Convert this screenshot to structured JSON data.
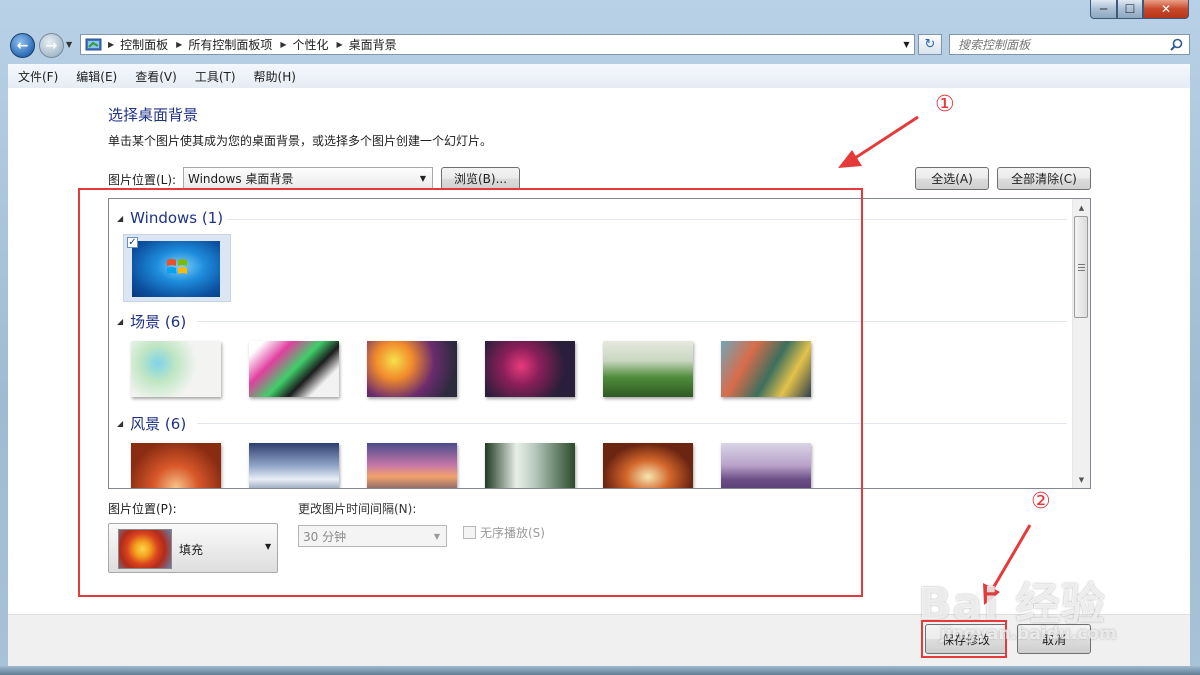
{
  "window": {
    "caption_min": "─",
    "caption_max": "☐",
    "caption_close": "✕"
  },
  "navigation": {
    "breadcrumbs": [
      "控制面板",
      "所有控制面板项",
      "个性化",
      "桌面背景"
    ],
    "search_placeholder": "搜索控制面板"
  },
  "menu": [
    "文件(F)",
    "编辑(E)",
    "查看(V)",
    "工具(T)",
    "帮助(H)"
  ],
  "page": {
    "title": "选择桌面背景",
    "subtitle": "单击某个图片使其成为您的桌面背景，或选择多个图片创建一个幻灯片。",
    "location_label": "图片位置(L):",
    "location_value": "Windows 桌面背景",
    "browse_label": "浏览(B)...",
    "select_all_label": "全选(A)",
    "clear_all_label": "全部清除(C)"
  },
  "gallery": {
    "groups": [
      {
        "label": "Windows (1)",
        "thumbnails": [
          "windows-7-logo"
        ],
        "checked": [
          true
        ]
      },
      {
        "label": "场景 (6)",
        "thumbnails": [
          "scene-1",
          "scene-2",
          "scene-3",
          "scene-4",
          "scene-5",
          "scene-6"
        ]
      },
      {
        "label": "风景 (6)",
        "thumbnails": [
          "landscape-1",
          "landscape-2",
          "landscape-3",
          "landscape-4",
          "landscape-5",
          "landscape-6"
        ]
      }
    ]
  },
  "options": {
    "position_label": "图片位置(P):",
    "position_value": "填充",
    "interval_label": "更改图片时间间隔(N):",
    "interval_value": "30 分钟",
    "shuffle_label": "无序播放(S)",
    "shuffle_checked": false
  },
  "footer": {
    "save_label": "保存修改",
    "cancel_label": "取消"
  },
  "annotations": {
    "marker_1": "①",
    "marker_2": "②",
    "accent_color": "#e53a3a"
  },
  "watermark": {
    "brand": "Bai 经验",
    "url": "jingyan.baidu.com"
  }
}
